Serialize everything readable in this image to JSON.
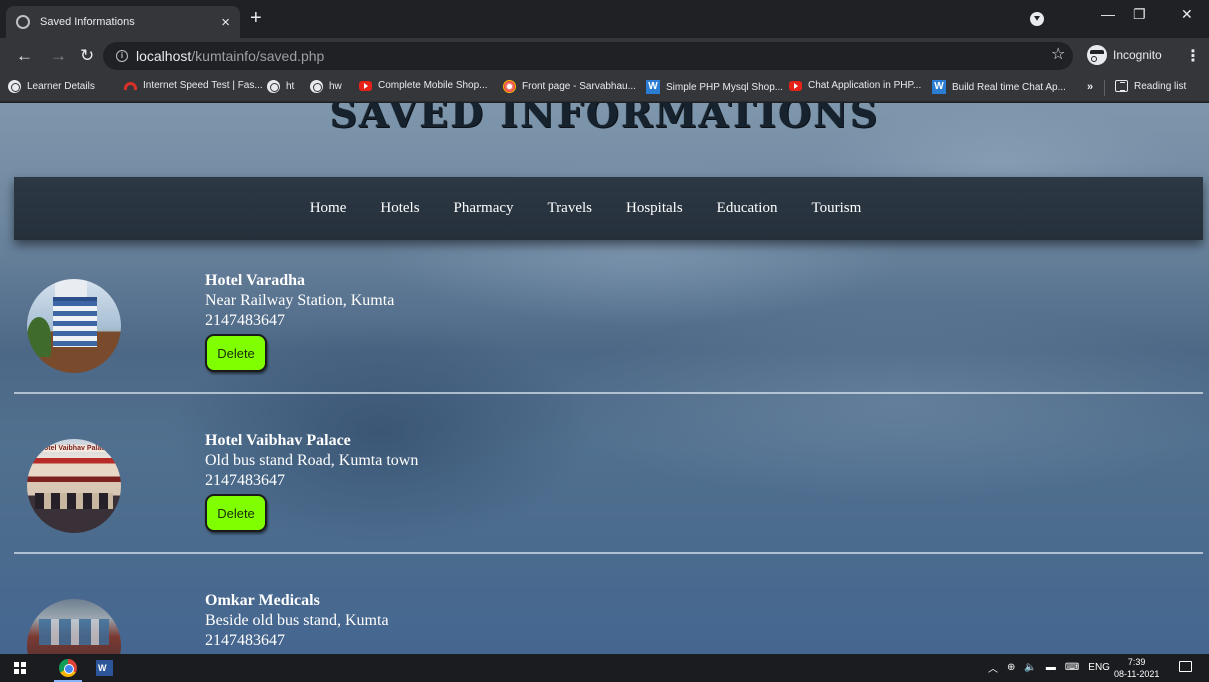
{
  "browser": {
    "tab_title": "Saved Informations",
    "tab_close": "×",
    "new_tab": "+",
    "url_host": "localhost",
    "url_path": "/kumtainfo/saved.php",
    "incognito_label": "Incognito",
    "bookmarks": [
      {
        "label": "Learner Details",
        "icon": "globe-icon"
      },
      {
        "label": "Internet Speed Test | Fas...",
        "icon": "speedometer-icon"
      },
      {
        "label": "ht",
        "icon": "globe-icon"
      },
      {
        "label": "hw",
        "icon": "globe-icon"
      },
      {
        "label": "Complete Mobile Shop...",
        "icon": "youtube-icon"
      },
      {
        "label": "Front page - Sarvabhau...",
        "icon": "target-icon"
      },
      {
        "label": "Simple PHP Mysql Shop...",
        "icon": "w-icon"
      },
      {
        "label": "Chat Application in PHP...",
        "icon": "youtube-icon"
      },
      {
        "label": "Build Real time Chat Ap...",
        "icon": "w-icon"
      }
    ],
    "bookmarks_more": "»",
    "reading_list": "Reading list"
  },
  "page": {
    "heading": "SAVED INFORMATIONS",
    "nav": [
      "Home",
      "Hotels",
      "Pharmacy",
      "Travels",
      "Hospitals",
      "Education",
      "Tourism"
    ],
    "entries": [
      {
        "name": "Hotel Varadha",
        "address": "Near Railway Station, Kumta",
        "phone": "2147483647",
        "delete_label": "Delete"
      },
      {
        "name": "Hotel Vaibhav Palace",
        "address": "Old bus stand Road, Kumta town",
        "phone": "2147483647",
        "delete_label": "Delete",
        "photo_sign": "Hotel Vaibhav Palace"
      },
      {
        "name": "Omkar Medicals",
        "address": "Beside old bus stand, Kumta",
        "phone": "2147483647"
      }
    ]
  },
  "taskbar": {
    "language": "ENG",
    "time": "7:39",
    "date": "08-11-2021"
  },
  "colors": {
    "delete_button": "#7fff00",
    "nav_bar": "#2a3540",
    "browser_chrome": "#35363a"
  }
}
